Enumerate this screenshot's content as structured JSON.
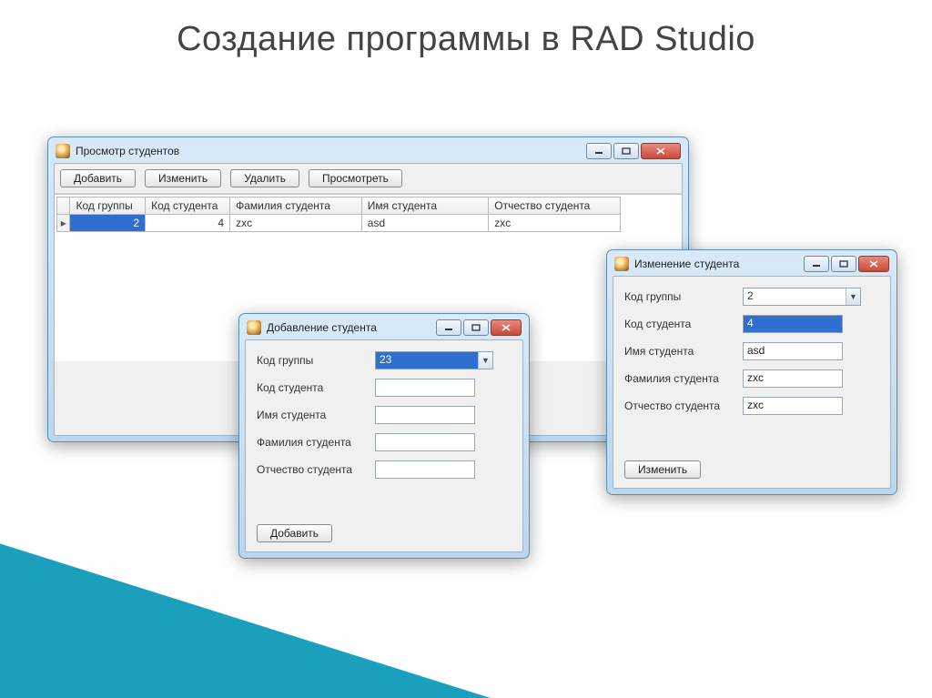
{
  "slide": {
    "title": "Создание программы в RAD Studio"
  },
  "viewWin": {
    "title": "Просмотр студентов",
    "toolbar": {
      "add": "Добавить",
      "edit": "Изменить",
      "del": "Удалить",
      "view": "Просмотреть"
    },
    "cols": {
      "group": "Код группы",
      "student": "Код студента",
      "lname": "Фамилия студента",
      "fname": "Имя студента",
      "mname": "Отчество студента"
    },
    "row": {
      "group": "2",
      "student": "4",
      "lname": "zxc",
      "fname": "asd",
      "mname": "zxc"
    }
  },
  "addWin": {
    "title": "Добавление студента",
    "labels": {
      "group": "Код группы",
      "student": "Код студента",
      "fname": "Имя студента",
      "lname": "Фамилия студента",
      "mname": "Отчество студента"
    },
    "values": {
      "group": "23"
    },
    "button": "Добавить"
  },
  "editWin": {
    "title": "Изменение студента",
    "labels": {
      "group": "Код группы",
      "student": "Код студента",
      "fname": "Имя студента",
      "lname": "Фамилия студента",
      "mname": "Отчество студента"
    },
    "values": {
      "group": "2",
      "student": "4",
      "fname": "asd",
      "lname": "zxc",
      "mname": "zxc"
    },
    "button": "Изменить"
  }
}
